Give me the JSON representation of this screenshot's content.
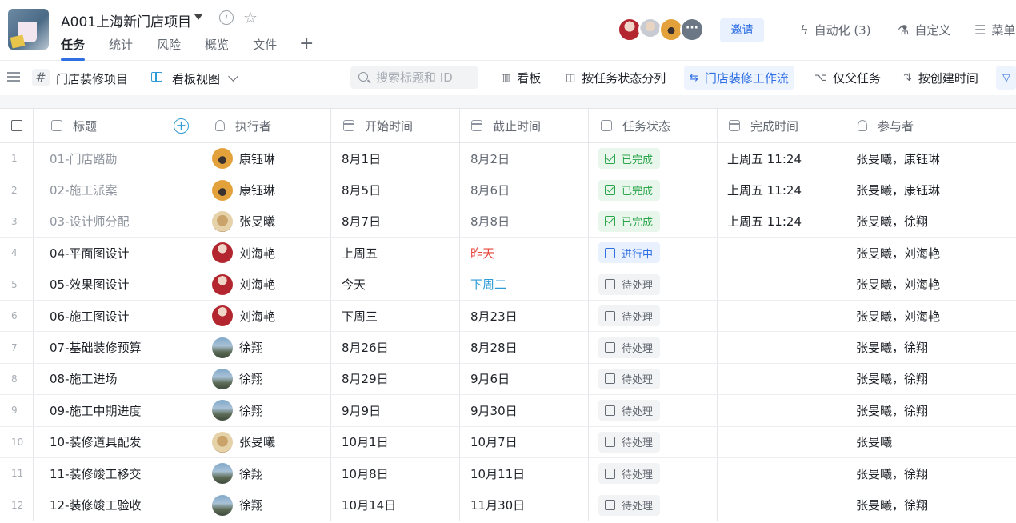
{
  "project": {
    "title": "A001上海新门店项目",
    "tabs": [
      {
        "label": "任务",
        "active": true
      },
      {
        "label": "统计"
      },
      {
        "label": "风险"
      },
      {
        "label": "概览"
      },
      {
        "label": "文件"
      }
    ]
  },
  "header_actions": {
    "invite": "邀请",
    "automation": "自动化 (3)",
    "customize": "自定义",
    "menu": "菜单"
  },
  "toolbar": {
    "group": "门店装修项目",
    "view": "看板视图",
    "search_placeholder": "搜索标题和 ID",
    "buttons": [
      "看板",
      "按任务状态分列",
      "门店装修工作流",
      "仅父任务",
      "按创建时间"
    ],
    "active_button": "门店装修工作流"
  },
  "columns": [
    "标题",
    "执行者",
    "开始时间",
    "截止时间",
    "任务状态",
    "完成时间",
    "参与者"
  ],
  "rows": [
    {
      "n": "1",
      "title": "01-门店踏勘",
      "assignee": "康钰琳",
      "avatar": "bear",
      "start": "8月1日",
      "due": "8月2日",
      "status": "已完成",
      "done": "上周五 11:24",
      "participants": "张旻曦，康钰琳"
    },
    {
      "n": "2",
      "title": "02-施工派案",
      "assignee": "康钰琳",
      "avatar": "bear",
      "start": "8月5日",
      "due": "8月6日",
      "status": "已完成",
      "done": "上周五 11:24",
      "participants": "张旻曦，康钰琳"
    },
    {
      "n": "3",
      "title": "03-设计师分配",
      "assignee": "张旻曦",
      "avatar": "bowl",
      "start": "8月7日",
      "due": "8月8日",
      "status": "已完成",
      "done": "上周五 11:24",
      "participants": "张旻曦，徐翔"
    },
    {
      "n": "4",
      "title": "04-平面图设计",
      "assignee": "刘海艳",
      "avatar": "red",
      "start": "上周五",
      "due": "昨天",
      "status": "进行中",
      "done": "",
      "participants": "张旻曦，刘海艳"
    },
    {
      "n": "5",
      "title": "05-效果图设计",
      "assignee": "刘海艳",
      "avatar": "red",
      "start": "今天",
      "due": "下周二",
      "status": "待处理",
      "done": "",
      "participants": "张旻曦，刘海艳"
    },
    {
      "n": "6",
      "title": "06-施工图设计",
      "assignee": "刘海艳",
      "avatar": "red",
      "start": "下周三",
      "due": "8月23日",
      "status": "待处理",
      "done": "",
      "participants": "张旻曦，刘海艳"
    },
    {
      "n": "7",
      "title": "07-基础装修预算",
      "assignee": "徐翔",
      "avatar": "sky",
      "start": "8月26日",
      "due": "8月28日",
      "status": "待处理",
      "done": "",
      "participants": "张旻曦，徐翔"
    },
    {
      "n": "8",
      "title": "08-施工进场",
      "assignee": "徐翔",
      "avatar": "sky",
      "start": "8月29日",
      "due": "9月6日",
      "status": "待处理",
      "done": "",
      "participants": "张旻曦，徐翔"
    },
    {
      "n": "9",
      "title": "09-施工中期进度",
      "assignee": "徐翔",
      "avatar": "sky",
      "start": "9月9日",
      "due": "9月30日",
      "status": "待处理",
      "done": "",
      "participants": "张旻曦，徐翔"
    },
    {
      "n": "10",
      "title": "10-装修道具配发",
      "assignee": "张旻曦",
      "avatar": "bowl",
      "start": "10月1日",
      "due": "10月7日",
      "status": "待处理",
      "done": "",
      "participants": "张旻曦"
    },
    {
      "n": "11",
      "title": "11-装修竣工移交",
      "assignee": "徐翔",
      "avatar": "sky",
      "start": "10月8日",
      "due": "10月11日",
      "status": "待处理",
      "done": "",
      "participants": "张旻曦，徐翔"
    },
    {
      "n": "12",
      "title": "12-装修竣工验收",
      "assignee": "徐翔",
      "avatar": "sky",
      "start": "10月14日",
      "due": "11月30日",
      "status": "待处理",
      "done": "",
      "participants": "张旻曦，徐翔"
    }
  ]
}
